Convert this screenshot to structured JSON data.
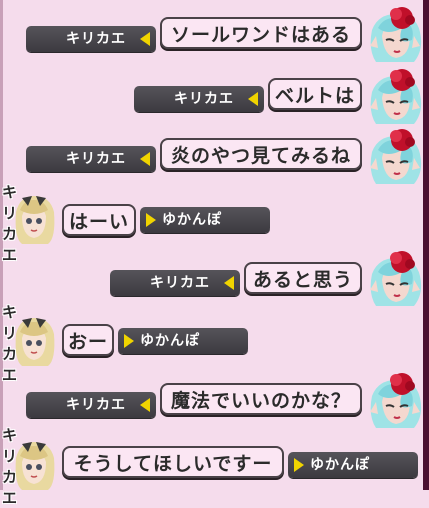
{
  "chat": {
    "messages": [
      {
        "speaker": "キリカエ",
        "text": "ソールワンドはある"
      },
      {
        "speaker": "キリカエ",
        "text": "ベルトは"
      },
      {
        "speaker": "キリカエ",
        "text": "炎のやつ見てみるね"
      },
      {
        "speaker": "ゆかんぽ",
        "speaker_label": "キリカエ",
        "text": "はーい"
      },
      {
        "speaker": "キリカエ",
        "text": "あると思う"
      },
      {
        "speaker": "ゆかんぽ",
        "speaker_label": "キリカエ",
        "text": "おー"
      },
      {
        "speaker": "キリカエ",
        "text": "魔法でいいのかな？"
      },
      {
        "speaker": "ゆかんぽ",
        "speaker_label": "キリカエ",
        "text": "そうしてほしいですー"
      }
    ]
  },
  "colors": {
    "background": "#f5dcec",
    "bubble": "#fbe6f3",
    "name_plate": "#48464c",
    "pointer": "#f0d400"
  },
  "icons": {
    "kirikae_avatar": "avatar-kirikae-icon",
    "yukanpo_avatar": "avatar-yukanpo-icon"
  }
}
